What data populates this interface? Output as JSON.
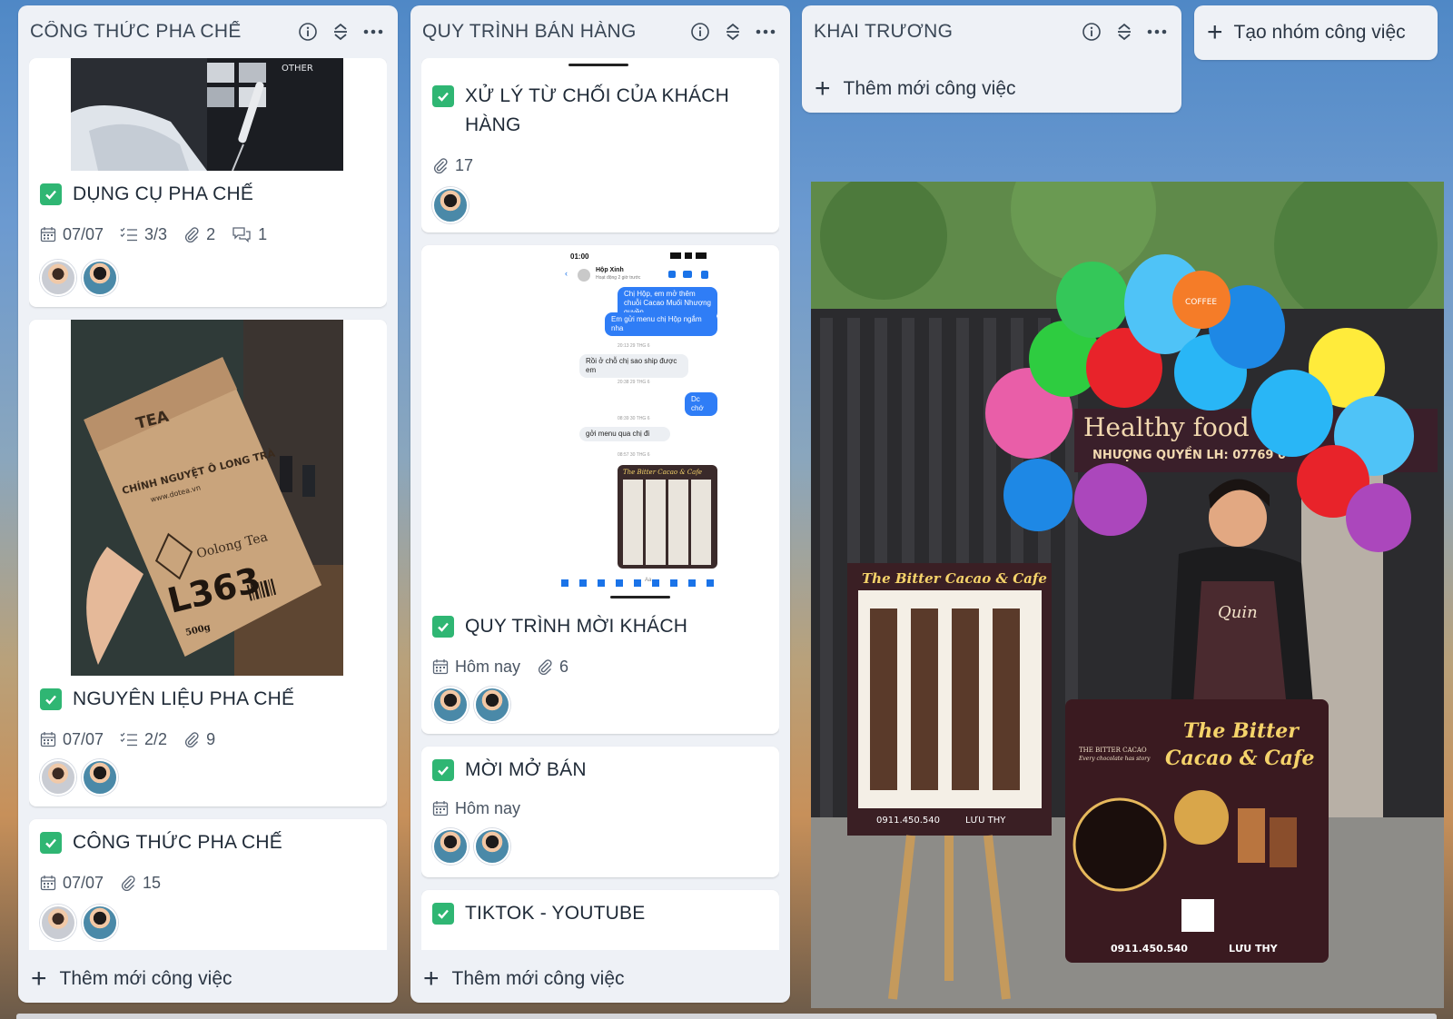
{
  "columns": [
    {
      "title": "CÔNG THỨC PHA CHẾ",
      "add_task": "Thêm mới công việc",
      "cards": [
        {
          "title": "DỤNG CỤ PHA CHẾ",
          "date": "07/07",
          "checklist": "3/3",
          "attachments": "2",
          "comments": "1"
        },
        {
          "title": "NGUYÊN LIỆU PHA CHẾ",
          "date": "07/07",
          "checklist": "2/2",
          "attachments": "9"
        },
        {
          "title": "CÔNG THỨC PHA CHẾ",
          "date": "07/07",
          "attachments": "15"
        }
      ],
      "thumb_texts": {
        "tea_label": "TEA",
        "tea_brand": "CHÍNH NGUYỆT Ô LONG TRÀ",
        "tea_site": "www.dotea.vn",
        "tea_kind": "Oolong Tea",
        "tea_code": "L363",
        "tea_weight": "500g",
        "box_brand": "OTHER"
      }
    },
    {
      "title": "QUY TRÌNH BÁN HÀNG",
      "add_task": "Thêm mới công việc",
      "cards": [
        {
          "title": "XỬ LÝ TỪ CHỐI CỦA KHÁCH HÀNG",
          "attachments": "17"
        },
        {
          "title": "QUY TRÌNH MỜI KHÁCH",
          "date": "Hôm nay",
          "attachments": "6"
        },
        {
          "title": "MỜI MỞ BÁN",
          "date": "Hôm nay"
        },
        {
          "title": "TIKTOK - YOUTUBE"
        }
      ],
      "chat": {
        "time": "01:00",
        "contact": "Hộp Xinh",
        "status": "Hoạt động 2 giờ trước",
        "msg1": "Chị Hộp, em mở thêm chuỗi Cacao Muối Nhượng quyền",
        "msg2": "Em gửi menu chị Hộp ngắm nha",
        "stamp1": "20:13 29 THG 6",
        "msg3": "Rồi ở chỗ chị sao ship được em",
        "stamp2": "20:38 29 THG 6",
        "msg4": "Dc chớ",
        "stamp3": "08:39 30 THG 6",
        "msg5": "gởi menu qua chị đi",
        "stamp4": "08:57 30 THG 6",
        "menu_title": "The Bitter Cacao & Cafe",
        "input_hint": "Aa"
      }
    },
    {
      "title": "KHAI TRƯƠNG",
      "add_task": "Thêm mới công việc"
    }
  ],
  "add_group": "Tạo nhóm công việc",
  "photo": {
    "banner_line1": "Healthy food &",
    "banner_line2": "NHƯỢNG QUYỀN LH: 07769 0",
    "board_title": "The Bitter Cacao & Cafe",
    "board_phone": "0911.450.540",
    "board_fb": "LƯU THY",
    "cart_title1": "The Bitter",
    "cart_title2": "Cacao & Cafe",
    "cart_brand": "THE BITTER CACAO",
    "cart_slogan": "Every chocolate has story",
    "cart_phone": "0911.450.540",
    "cart_fb": "LƯU THY",
    "apron_logo": "Quin",
    "balloon_text": "COFFEE"
  },
  "colors": {
    "check_green": "#2fb673",
    "column_bg": "#eef1f6",
    "card_bg": "#ffffff",
    "text_dark": "#1f2a37"
  }
}
